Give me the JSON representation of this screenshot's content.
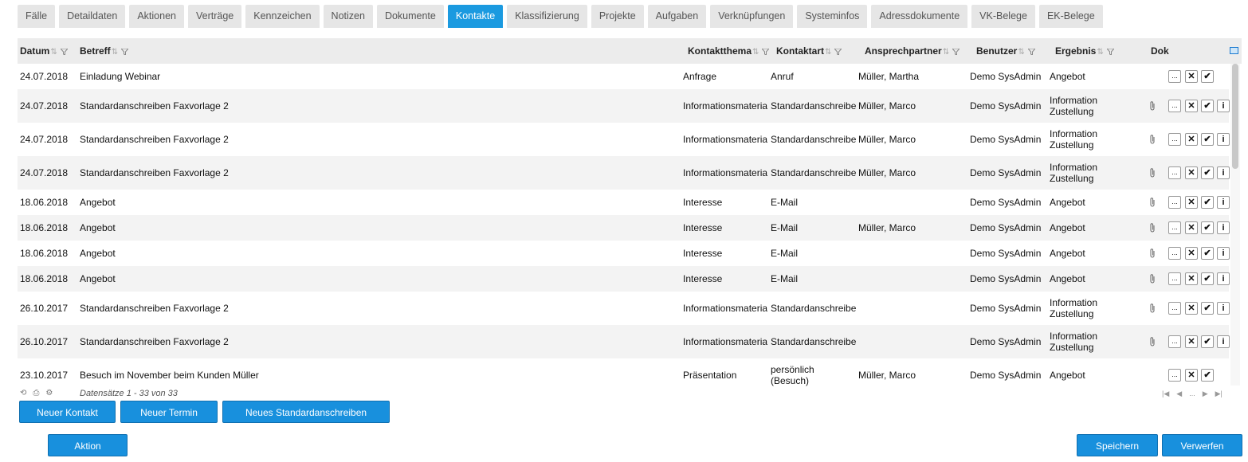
{
  "tabs": [
    {
      "label": "Fälle",
      "active": false
    },
    {
      "label": "Detaildaten",
      "active": false
    },
    {
      "label": "Aktionen",
      "active": false
    },
    {
      "label": "Verträge",
      "active": false
    },
    {
      "label": "Kennzeichen",
      "active": false
    },
    {
      "label": "Notizen",
      "active": false
    },
    {
      "label": "Dokumente",
      "active": false
    },
    {
      "label": "Kontakte",
      "active": true
    },
    {
      "label": "Klassifizierung",
      "active": false
    },
    {
      "label": "Projekte",
      "active": false
    },
    {
      "label": "Aufgaben",
      "active": false
    },
    {
      "label": "Verknüpfungen",
      "active": false
    },
    {
      "label": "Systeminfos",
      "active": false
    },
    {
      "label": "Adressdokumente",
      "active": false
    },
    {
      "label": "VK-Belege",
      "active": false
    },
    {
      "label": "EK-Belege",
      "active": false
    }
  ],
  "columns": {
    "datum": "Datum",
    "betreff": "Betreff",
    "kontaktthema": "Kontaktthema",
    "kontaktart": "Kontaktart",
    "ansprechpartner": "Ansprechpartner",
    "benutzer": "Benutzer",
    "ergebnis": "Ergebnis",
    "dok": "Dok"
  },
  "rows": [
    {
      "datum": "24.07.2018",
      "betreff": "Einladung Webinar",
      "thema": "Anfrage",
      "art": [
        "Anruf"
      ],
      "ansprechpartner": "Müller, Martha",
      "benutzer": "Demo SysAdmin",
      "ergebnis": [
        "Angebot"
      ],
      "attachment": false,
      "info": false
    },
    {
      "datum": "24.07.2018",
      "betreff": "Standardanschreiben Faxvorlage 2",
      "thema": "Informationsmateria",
      "art": [
        "Standardanschreibe"
      ],
      "ansprechpartner": "Müller, Marco",
      "benutzer": "Demo SysAdmin",
      "ergebnis": [
        "Information",
        "Zustellung"
      ],
      "attachment": true,
      "info": true
    },
    {
      "datum": "24.07.2018",
      "betreff": "Standardanschreiben Faxvorlage 2",
      "thema": "Informationsmateria",
      "art": [
        "Standardanschreibe"
      ],
      "ansprechpartner": "Müller, Marco",
      "benutzer": "Demo SysAdmin",
      "ergebnis": [
        "Information",
        "Zustellung"
      ],
      "attachment": true,
      "info": true
    },
    {
      "datum": "24.07.2018",
      "betreff": "Standardanschreiben Faxvorlage 2",
      "thema": "Informationsmateria",
      "art": [
        "Standardanschreibe"
      ],
      "ansprechpartner": "Müller, Marco",
      "benutzer": "Demo SysAdmin",
      "ergebnis": [
        "Information",
        "Zustellung"
      ],
      "attachment": true,
      "info": true
    },
    {
      "datum": "18.06.2018",
      "betreff": "Angebot",
      "thema": "Interesse",
      "art": [
        "E-Mail"
      ],
      "ansprechpartner": "",
      "benutzer": "Demo SysAdmin",
      "ergebnis": [
        "Angebot"
      ],
      "attachment": true,
      "info": true
    },
    {
      "datum": "18.06.2018",
      "betreff": "Angebot",
      "thema": "Interesse",
      "art": [
        "E-Mail"
      ],
      "ansprechpartner": "Müller, Marco",
      "benutzer": "Demo SysAdmin",
      "ergebnis": [
        "Angebot"
      ],
      "attachment": true,
      "info": true
    },
    {
      "datum": "18.06.2018",
      "betreff": "Angebot",
      "thema": "Interesse",
      "art": [
        "E-Mail"
      ],
      "ansprechpartner": "",
      "benutzer": "Demo SysAdmin",
      "ergebnis": [
        "Angebot"
      ],
      "attachment": true,
      "info": true
    },
    {
      "datum": "18.06.2018",
      "betreff": "Angebot",
      "thema": "Interesse",
      "art": [
        "E-Mail"
      ],
      "ansprechpartner": "",
      "benutzer": "Demo SysAdmin",
      "ergebnis": [
        "Angebot"
      ],
      "attachment": true,
      "info": true
    },
    {
      "datum": "26.10.2017",
      "betreff": "Standardanschreiben Faxvorlage 2",
      "thema": "Informationsmateria",
      "art": [
        "Standardanschreibe"
      ],
      "ansprechpartner": "",
      "benutzer": "Demo SysAdmin",
      "ergebnis": [
        "Information",
        "Zustellung"
      ],
      "attachment": true,
      "info": true
    },
    {
      "datum": "26.10.2017",
      "betreff": "Standardanschreiben Faxvorlage 2",
      "thema": "Informationsmateria",
      "art": [
        "Standardanschreibe"
      ],
      "ansprechpartner": "",
      "benutzer": "Demo SysAdmin",
      "ergebnis": [
        "Information",
        "Zustellung"
      ],
      "attachment": true,
      "info": true
    },
    {
      "datum": "23.10.2017",
      "betreff": "Besuch im November beim Kunden Müller",
      "thema": "Präsentation",
      "art": [
        "persönlich",
        "(Besuch)"
      ],
      "ansprechpartner": "Müller, Marco",
      "benutzer": "Demo SysAdmin",
      "ergebnis": [
        "Angebot"
      ],
      "attachment": false,
      "info": false
    }
  ],
  "row_buttons": {
    "more": "...",
    "delete": "✕",
    "done": "✔",
    "info": "i"
  },
  "footer": {
    "status": "Datensätze 1 - 33 von 33",
    "pager_dots": "..."
  },
  "buttons": {
    "neuer_kontakt": "Neuer Kontakt",
    "neuer_termin": "Neuer Termin",
    "neues_standardanschreiben": "Neues Standardanschreiben",
    "aktion": "Aktion",
    "speichern": "Speichern",
    "verwerfen": "Verwerfen"
  },
  "colors": {
    "accent": "#1b9ae0",
    "button": "#1890dd",
    "header_bg": "#ececec",
    "row_alt": "#f3f3f3"
  }
}
